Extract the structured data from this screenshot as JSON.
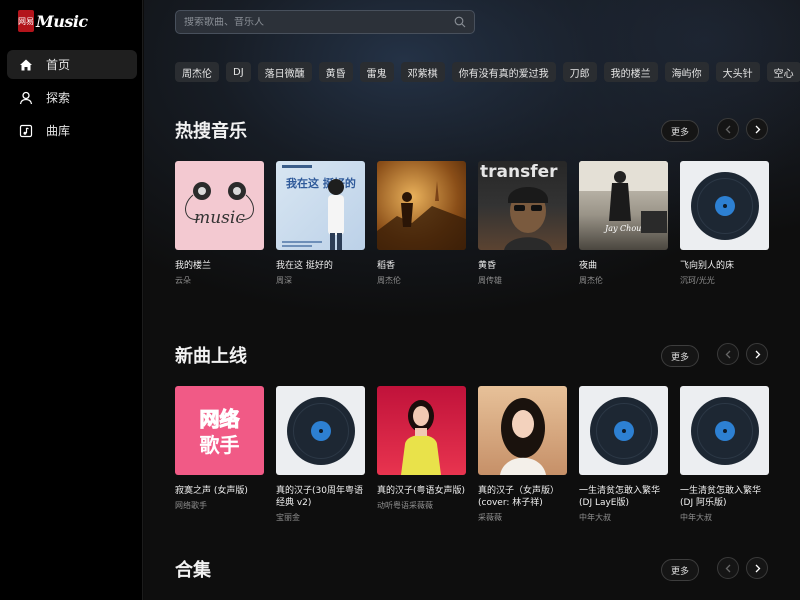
{
  "app": {
    "logo_seal": "网易",
    "logo_text": "Music"
  },
  "sidebar": {
    "items": [
      {
        "label": "首页",
        "icon": "home-icon",
        "active": true
      },
      {
        "label": "探索",
        "icon": "user-icon",
        "active": false
      },
      {
        "label": "曲库",
        "icon": "library-icon",
        "active": false
      }
    ]
  },
  "search": {
    "placeholder": "搜索歌曲、音乐人"
  },
  "hot_tags": [
    "周杰伦",
    "DJ",
    "落日微醺",
    "黄昏",
    "雷鬼",
    "邓紫棋",
    "你有没有真的爱过我",
    "刀郎",
    "我的楼兰",
    "海屿你",
    "大头针",
    "空心"
  ],
  "sections": {
    "hot": {
      "title": "热搜音乐",
      "more": "更多",
      "items": [
        {
          "title": "我的楼兰",
          "artist": "云朵",
          "cover": "music-cassette-cover"
        },
        {
          "title": "我在这 挺好的",
          "artist": "周深",
          "cover": "portrait-cover"
        },
        {
          "title": "稻香",
          "artist": "周杰伦",
          "cover": "painting-cover"
        },
        {
          "title": "黄昏",
          "artist": "周传雄",
          "cover": "transfer-cover"
        },
        {
          "title": "夜曲",
          "artist": "周杰伦",
          "cover": "night-song-cover"
        },
        {
          "title": "飞向别人的床",
          "artist": "沉珂/光光",
          "cover": "vinyl-cover"
        }
      ]
    },
    "new": {
      "title": "新曲上线",
      "more": "更多",
      "items": [
        {
          "title": "寂寞之声 (女声版)",
          "artist": "网络歌手",
          "cover": "net-singer-cover"
        },
        {
          "title": "真的汉子(30周年粤语经典 v2)",
          "artist": "宝丽金",
          "cover": "vinyl-cover"
        },
        {
          "title": "真的汉子(粤语女声版)",
          "artist": "动听粤语采薇薇",
          "cover": "singer-red-cover"
        },
        {
          "title": "真的汉子（女声版）(cover: 林子祥)",
          "artist": "采薇薇",
          "cover": "singer-warm-cover"
        },
        {
          "title": "一生清贫怎敢入繁华 (DJ LayE版)",
          "artist": "中年大叔",
          "cover": "vinyl-cover"
        },
        {
          "title": "一生清贫怎敢入繁华 (DJ 阿乐版)",
          "artist": "中年大叔",
          "cover": "vinyl-cover"
        }
      ]
    },
    "collection": {
      "title": "合集",
      "more": "更多"
    }
  },
  "cover_text": {
    "music": "music",
    "wozai_big": "我在这 挺好的",
    "transfer": "transfer",
    "yequ": "Jay Chou",
    "wangluo_top": "网络",
    "wangluo_bottom": "歌手"
  }
}
